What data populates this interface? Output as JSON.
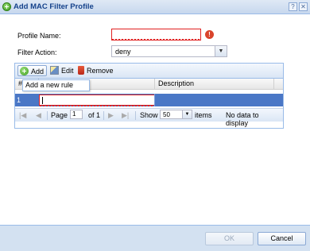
{
  "window": {
    "title": "Add MAC Filter Profile",
    "help_label": "?",
    "close_label": "✕"
  },
  "form": {
    "profile_name_label": "Profile Name:",
    "profile_name_value": "",
    "error_icon_glyph": "!",
    "filter_action_label": "Filter Action:",
    "filter_action_value": "deny"
  },
  "grid": {
    "toolbar": {
      "add_label": "Add",
      "edit_label": "Edit",
      "remove_label": "Remove"
    },
    "columns": [
      "#",
      "MAC Address",
      "Description"
    ],
    "rows": [
      {
        "num": "1",
        "mac": "",
        "description": ""
      }
    ],
    "tooltip": "Add a new rule",
    "pager": {
      "page_label": "Page",
      "page_value": "1",
      "of_label": "of 1",
      "show_label": "Show",
      "show_value": "50",
      "items_label": "items",
      "status": "No data to display",
      "first": "|◀",
      "prev": "◀",
      "next": "▶",
      "last": "▶|"
    }
  },
  "footer": {
    "ok_label": "OK",
    "cancel_label": "Cancel"
  },
  "colors": {
    "error": "#e02020",
    "selected_row": "#4a77c6",
    "title_text": "#15428b"
  }
}
